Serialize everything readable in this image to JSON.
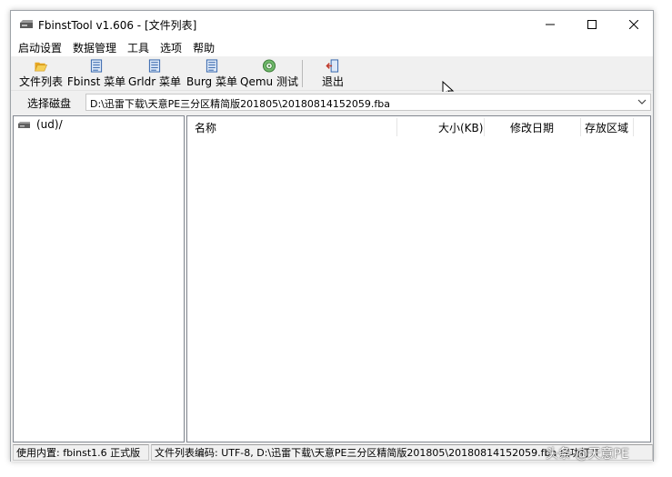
{
  "window": {
    "title": "FbinstTool v1.606 - [文件列表]"
  },
  "menu": [
    {
      "label": "启动设置"
    },
    {
      "label": "数据管理"
    },
    {
      "label": "工具"
    },
    {
      "label": "选项"
    },
    {
      "label": "帮助"
    }
  ],
  "toolbar": {
    "file_list": "文件列表",
    "fbinst_menu": "Fbinst 菜单",
    "grldr_menu": "Grldr 菜单",
    "burg_menu": "Burg 菜单",
    "qemu_test": "Qemu 测试",
    "exit": "退出"
  },
  "disk": {
    "label": "选择磁盘",
    "value": "D:\\迅雷下载\\天意PE三分区精简版201805\\20180814152059.fba"
  },
  "tree": {
    "root": "(ud)/"
  },
  "list": {
    "columns": [
      "名称",
      "大小(KB)",
      "修改日期",
      "存放区域"
    ],
    "rows": []
  },
  "status": {
    "kernel": "使用内置: fbinst1.6 正式版",
    "encoding": "文件列表编码: UTF-8, D:\\迅雷下载\\天意PE三分区精简版201805\\20180814152059.fba 成功打开"
  },
  "watermark": "头条 @天意PE",
  "colors": {
    "window_bg": "#f0f0f0",
    "panel_border": "#828790",
    "icon_blue": "#2c5fa8",
    "folder_yellow": "#f3c343"
  }
}
